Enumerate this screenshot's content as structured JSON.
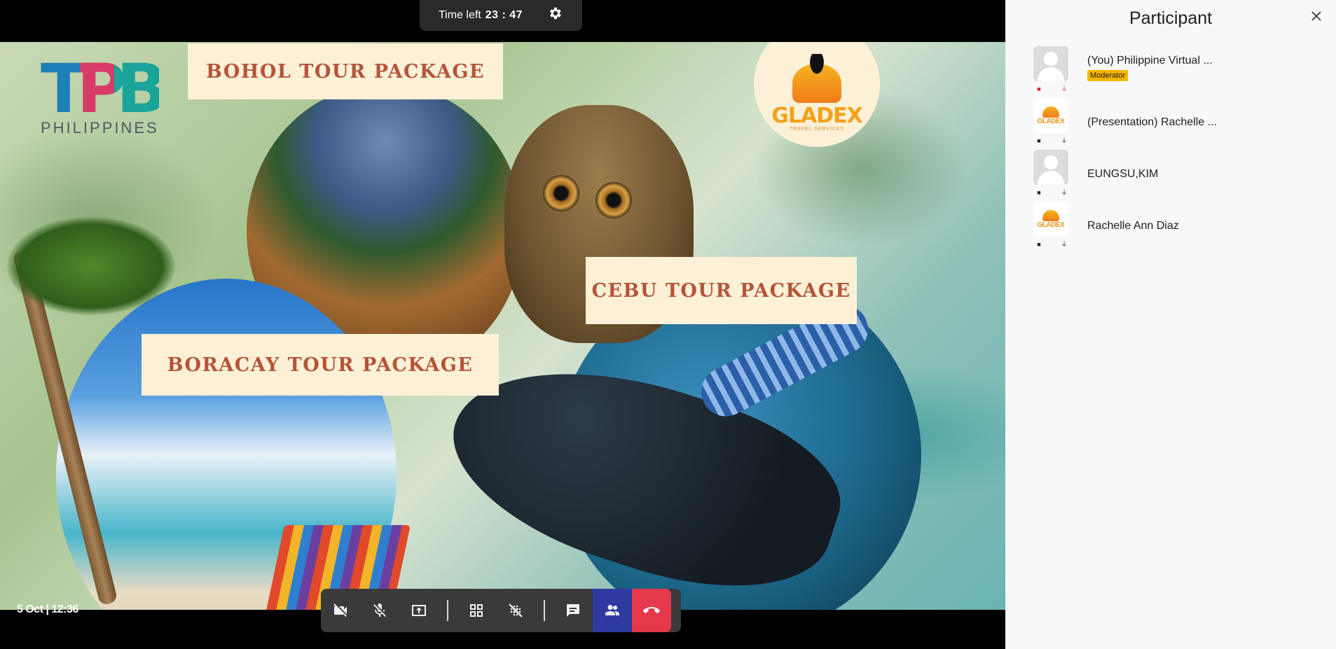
{
  "meeting": {
    "timer_label": "Time left",
    "timer_value": "23 : 47",
    "date_time": "5 Oct | 12:36"
  },
  "slide": {
    "brand_left_big": "TPB",
    "brand_left_small": "PHILIPPINES",
    "brand_right_name": "GLADEX",
    "brand_right_sub": "TRAVEL SERVICES",
    "labels": {
      "bohol": "BOHOL TOUR PACKAGE",
      "cebu": "CEBU TOUR PACKAGE",
      "boracay": "BORACAY TOUR PACKAGE"
    }
  },
  "toolbar": {
    "buttons": [
      {
        "icon": "camera-off-icon"
      },
      {
        "icon": "mic-off-icon"
      },
      {
        "icon": "share-screen-icon"
      },
      {
        "icon": "grid-view-icon"
      },
      {
        "icon": "background-effects-icon"
      },
      {
        "icon": "chat-icon"
      },
      {
        "icon": "participants-icon",
        "active": true
      },
      {
        "icon": "hang-up-icon"
      }
    ],
    "colors": {
      "bar": "#3a3a3a",
      "active": "#2f3aa0",
      "hangup": "#e3394b"
    }
  },
  "panel": {
    "title": "Participant",
    "participants": [
      {
        "name": "(You) Philippine Virtual ...",
        "badge": "Moderator",
        "avatar": "person",
        "camera": "off",
        "mic": "off"
      },
      {
        "name": "(Presentation) Rachelle ...",
        "badge": "",
        "avatar": "gladex-logo",
        "camera": "on",
        "mic": "on"
      },
      {
        "name": "EUNGSU,KIM",
        "badge": "",
        "avatar": "person",
        "camera": "on",
        "mic": "on"
      },
      {
        "name": "Rachelle Ann Diaz",
        "badge": "",
        "avatar": "gladex-logo",
        "camera": "on",
        "mic": "on"
      }
    ],
    "avatar_logo_text": "GLADEX"
  }
}
